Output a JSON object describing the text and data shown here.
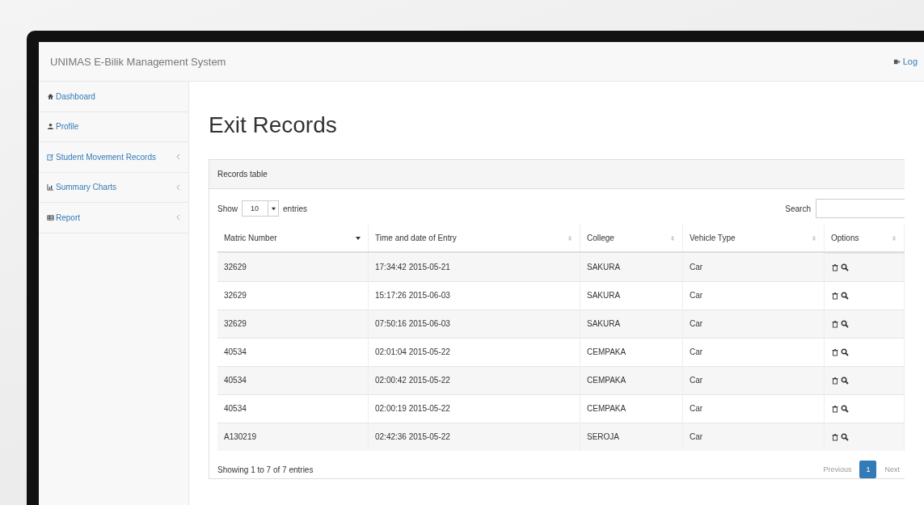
{
  "navbar": {
    "brand": "UNIMAS E-Bilik Management System",
    "logout": "Log"
  },
  "sidebar": {
    "items": [
      {
        "label": "Dashboard",
        "has_submenu": false
      },
      {
        "label": "Profile",
        "has_submenu": false
      },
      {
        "label": "Student Movement Records",
        "has_submenu": true
      },
      {
        "label": "Summary Charts",
        "has_submenu": true
      },
      {
        "label": "Report",
        "has_submenu": true
      }
    ]
  },
  "page_title": "Exit Records",
  "panel": {
    "heading": "Records table",
    "show_label": "Show",
    "page_size": "10",
    "entries_label": "entries",
    "search_label": "Search",
    "table": {
      "columns": [
        {
          "label": "Matric Number",
          "sorted": true
        },
        {
          "label": "Time and date of Entry",
          "sorted": false
        },
        {
          "label": "College",
          "sorted": false
        },
        {
          "label": "Vehicle Type",
          "sorted": false
        },
        {
          "label": "Options",
          "sorted": false
        }
      ],
      "rows": [
        [
          "32629",
          "17:34:42 2015-05-21",
          "SAKURA",
          "Car"
        ],
        [
          "32629",
          "15:17:26 2015-06-03",
          "SAKURA",
          "Car"
        ],
        [
          "32629",
          "07:50:16 2015-06-03",
          "SAKURA",
          "Car"
        ],
        [
          "40534",
          "02:01:04 2015-05-22",
          "CEMPAKA",
          "Car"
        ],
        [
          "40534",
          "02:00:42 2015-05-22",
          "CEMPAKA",
          "Car"
        ],
        [
          "40534",
          "02:00:19 2015-05-22",
          "CEMPAKA",
          "Car"
        ],
        [
          "A130219",
          "02:42:36 2015-05-22",
          "SEROJA",
          "Car"
        ]
      ]
    },
    "info": "Showing 1 to 7 of 7 entries",
    "pagination": [
      {
        "label": "Previous",
        "kind": "nav",
        "selected": false
      },
      {
        "label": "1",
        "kind": "page",
        "selected": true
      },
      {
        "label": "Next",
        "kind": "nav",
        "selected": false
      }
    ]
  }
}
